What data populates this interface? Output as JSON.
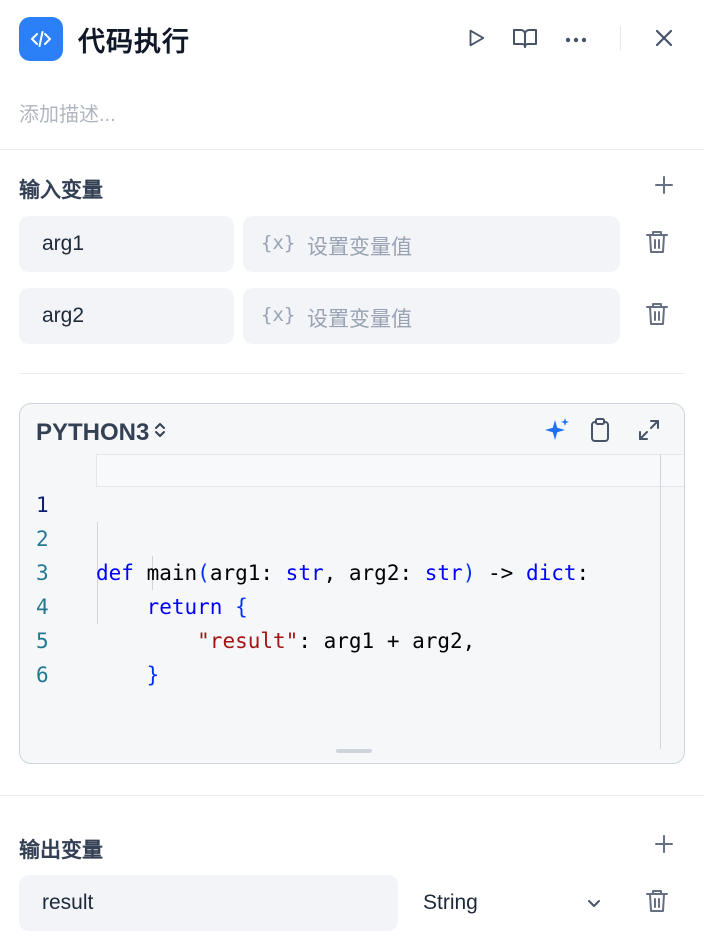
{
  "header": {
    "title": "代码执行",
    "description_placeholder": "添加描述...",
    "icons": {
      "app": "code-brackets-icon",
      "run": "play-icon",
      "docs": "book-icon",
      "more": "more-horizontal-icon",
      "close": "close-icon"
    }
  },
  "inputs": {
    "title": "输入变量",
    "add_icon": "plus-icon",
    "delete_icon": "trash-icon",
    "value_icon_text": "{x}",
    "items": [
      {
        "name": "arg1",
        "value_placeholder": "设置变量值"
      },
      {
        "name": "arg2",
        "value_placeholder": "设置变量值"
      }
    ]
  },
  "editor": {
    "language": "PYTHON3",
    "language_chevron": "⌃⌄",
    "tools": [
      "sparkle-ai-icon",
      "clipboard-icon",
      "expand-icon"
    ],
    "line_numbers": [
      "1",
      "2",
      "3",
      "4",
      "5",
      "6"
    ],
    "lines": {
      "l2": {
        "kw_def": "def",
        "fn": " main",
        "p1": "(",
        "a1": "arg1: ",
        "t1": "str",
        "c1": ", arg2: ",
        "t2": "str",
        "p2": ")",
        "arrow": " -> ",
        "t3": "dict",
        "colon": ":"
      },
      "l3": {
        "kw": "return",
        "brace": " {"
      },
      "l4": {
        "str": "\"result\"",
        "rest": ": arg1 + arg2,"
      },
      "l5": {
        "brace": "}"
      }
    },
    "colors": {
      "keyword": "#0000ff",
      "type": "#0000ff",
      "string": "#a31515",
      "line_number": "#237893"
    }
  },
  "outputs": {
    "title": "输出变量",
    "add_icon": "plus-icon",
    "delete_icon": "trash-icon",
    "items": [
      {
        "name": "result",
        "type": "String"
      }
    ]
  },
  "colors": {
    "accent": "#2b7ff7",
    "field_bg": "#f2f4f7"
  }
}
